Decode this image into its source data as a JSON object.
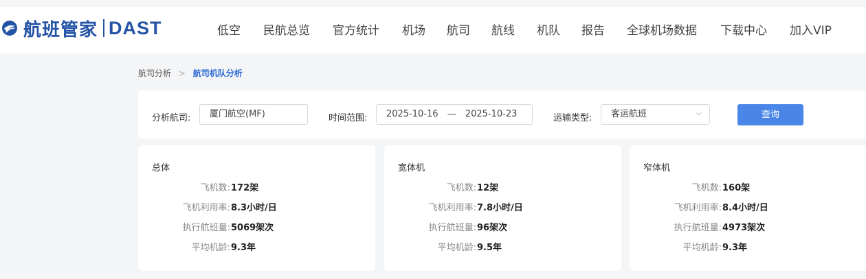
{
  "header": {
    "logo_cn": "航班管家",
    "logo_en": "DAST",
    "nav": [
      "低空",
      "民航总览",
      "官方统计",
      "机场",
      "航司",
      "航线",
      "机队",
      "报告",
      "全球机场数据",
      "下载中心",
      "加入VIP"
    ]
  },
  "breadcrumb": {
    "parent": "航司分析",
    "sep": ">",
    "current": "航司机队分析"
  },
  "filter": {
    "airline_label": "分析航司:",
    "airline_value": "厦门航空(MF)",
    "date_label": "时间范围:",
    "date_start": "2025-10-16",
    "date_sep": "—",
    "date_end": "2025-10-23",
    "type_label": "运输类型:",
    "type_value": "客运航班",
    "query_button": "查询"
  },
  "cards": [
    {
      "title": "总体",
      "rows": [
        {
          "k": "飞机数:",
          "v": "172架"
        },
        {
          "k": "飞机利用率:",
          "v": "8.3小时/日"
        },
        {
          "k": "执行航班量:",
          "v": "5069架次"
        },
        {
          "k": "平均机龄:",
          "v": "9.3年"
        }
      ]
    },
    {
      "title": "宽体机",
      "rows": [
        {
          "k": "飞机数:",
          "v": "12架"
        },
        {
          "k": "飞机利用率:",
          "v": "7.8小时/日"
        },
        {
          "k": "执行航班量:",
          "v": "96架次"
        },
        {
          "k": "平均机龄:",
          "v": "9.5年"
        }
      ]
    },
    {
      "title": "窄体机",
      "rows": [
        {
          "k": "飞机数:",
          "v": "160架"
        },
        {
          "k": "飞机利用率:",
          "v": "8.4小时/日"
        },
        {
          "k": "执行航班量:",
          "v": "4973架次"
        },
        {
          "k": "平均机龄:",
          "v": "9.3年"
        }
      ]
    }
  ],
  "colors": {
    "brand": "#2453a6",
    "accent": "#4a86e8",
    "link": "#2d6ad6",
    "page_bg": "#f4f5f7"
  }
}
